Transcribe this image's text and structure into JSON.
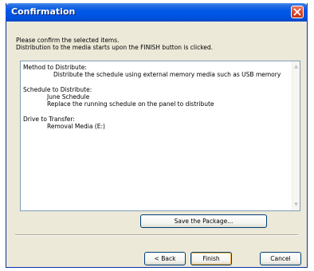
{
  "window": {
    "title": "Confirmation"
  },
  "intro": {
    "line1": "Please confirm the selected items.",
    "line2": "Distribution to the media starts upon the FINISH button is clicked."
  },
  "summary": {
    "method_heading": "Method to Distribute:",
    "method_value": "Distribute the schedule using external memory media such as USB memory",
    "schedule_heading": "Schedule to Distribute:",
    "schedule_name": "June Schedule",
    "schedule_action": "Replace the running schedule on the panel to distribute",
    "drive_heading": "Drive to Transfer:",
    "drive_value": "Removal Media (E:)"
  },
  "buttons": {
    "save_package": "Save the Package...",
    "back": "< Back",
    "finish": "Finish",
    "cancel": "Cancel"
  },
  "icons": {
    "close": "close-icon",
    "scroll_up": "scroll-up-icon",
    "scroll_down": "scroll-down-icon"
  },
  "colors": {
    "titlebar": "#0054e3",
    "dialog_bg": "#ece9d8",
    "close_button": "#d6442a"
  }
}
